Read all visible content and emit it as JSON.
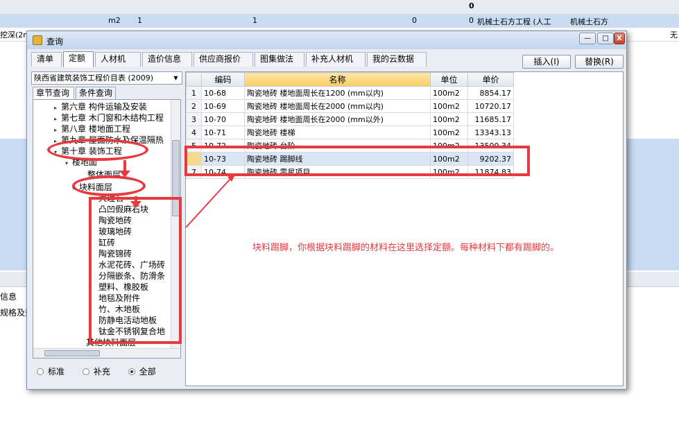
{
  "background": {
    "row0_value": "0",
    "row1": {
      "unit": "m2",
      "qty1": "1",
      "qty2": "1",
      "v0a": "0",
      "v0b": "0",
      "desc1": "机械土石方工程 (人工",
      "desc2": "机械土石方"
    },
    "row2_left": "挖深(2m)",
    "row2_right": "无",
    "side_label1": "信息",
    "side_label2": "规格及型"
  },
  "window": {
    "title": "查询",
    "controls": {
      "minimize": "—",
      "maximize": "□",
      "close": "X"
    },
    "tabs": [
      "清单",
      "定额",
      "人材机",
      "造价信息",
      "供应商报价",
      "图集做法",
      "补充人材机",
      "我的云数据"
    ],
    "active_tab": "定额",
    "insert_button": "插入(I)",
    "replace_button": "替换(R)",
    "library_select": "陕西省建筑装饰工程价目表 (2009)",
    "subtabs": [
      "章节查询",
      "条件查询"
    ],
    "tree": [
      {
        "label": "第六章  构件运输及安装",
        "level": 0,
        "expander": "▸"
      },
      {
        "label": "第七章  木门窗和木结构工程",
        "level": 0,
        "expander": "▸"
      },
      {
        "label": "第八章  楼地面工程",
        "level": 0,
        "expander": "▸"
      },
      {
        "label": "第九章  屋面防水及保温隔热",
        "level": 0,
        "expander": "▸"
      },
      {
        "label": "第十章  装饰工程",
        "level": 0,
        "expander": "▾"
      },
      {
        "label": "楼地面",
        "level": 1,
        "expander": "▾"
      },
      {
        "label": "整体面层",
        "level": 2,
        "expander": ""
      },
      {
        "label": "块料面层",
        "level": 2,
        "expander": "▾"
      },
      {
        "label": "大理石",
        "level": 3,
        "expander": ""
      },
      {
        "label": "凸凹假麻石块",
        "level": 3,
        "expander": ""
      },
      {
        "label": "陶瓷地砖",
        "level": 3,
        "expander": ""
      },
      {
        "label": "玻璃地砖",
        "level": 3,
        "expander": ""
      },
      {
        "label": "缸砖",
        "level": 3,
        "expander": ""
      },
      {
        "label": "陶瓷锦砖",
        "level": 3,
        "expander": ""
      },
      {
        "label": "水泥花砖、广场砖",
        "level": 3,
        "expander": ""
      },
      {
        "label": "分隔嵌条、防滑条",
        "level": 3,
        "expander": ""
      },
      {
        "label": "塑料、橡胶板",
        "level": 3,
        "expander": ""
      },
      {
        "label": "地毯及附件",
        "level": 3,
        "expander": ""
      },
      {
        "label": "竹、木地板",
        "level": 3,
        "expander": ""
      },
      {
        "label": "防静电活动地板",
        "level": 3,
        "expander": ""
      },
      {
        "label": "钛金不锈钢复合地",
        "level": 3,
        "expander": ""
      },
      {
        "label": "其他块料面层",
        "level": 2,
        "expander": ""
      }
    ],
    "radio_options": [
      "标准",
      "补充",
      "全部"
    ],
    "radio_selected": "全部",
    "table": {
      "headers": [
        "编码",
        "名称",
        "单位",
        "单价"
      ],
      "rows": [
        {
          "n": "1",
          "code": "10-68",
          "name": "陶瓷地砖 楼地面周长在1200 (mm以内)",
          "unit": "100m2",
          "price": "8854.17"
        },
        {
          "n": "2",
          "code": "10-69",
          "name": "陶瓷地砖 楼地面周长在2000 (mm以内)",
          "unit": "100m2",
          "price": "10720.17"
        },
        {
          "n": "3",
          "code": "10-70",
          "name": "陶瓷地砖 楼地面周长在2000 (mm以外)",
          "unit": "100m2",
          "price": "11685.17"
        },
        {
          "n": "4",
          "code": "10-71",
          "name": "陶瓷地砖 楼梯",
          "unit": "100m2",
          "price": "13343.13"
        },
        {
          "n": "5",
          "code": "10-72",
          "name": "陶瓷地砖 台阶",
          "unit": "100m2",
          "price": "13500.34"
        },
        {
          "n": "6",
          "code": "10-73",
          "name": "陶瓷地砖 踢脚线",
          "unit": "100m2",
          "price": "9202.37"
        },
        {
          "n": "7",
          "code": "10-74",
          "name": "陶瓷地砖 零星项目",
          "unit": "100m2",
          "price": "11874.83"
        }
      ]
    }
  },
  "annotation_text": "块料踢脚，你根据块料踢脚的材料在这里选择定额。每种材料下都有踢脚的。",
  "colors": {
    "annotation": "#e8393f",
    "selected_header": "#f8cc64",
    "selected_row": "#dbe6f4"
  }
}
